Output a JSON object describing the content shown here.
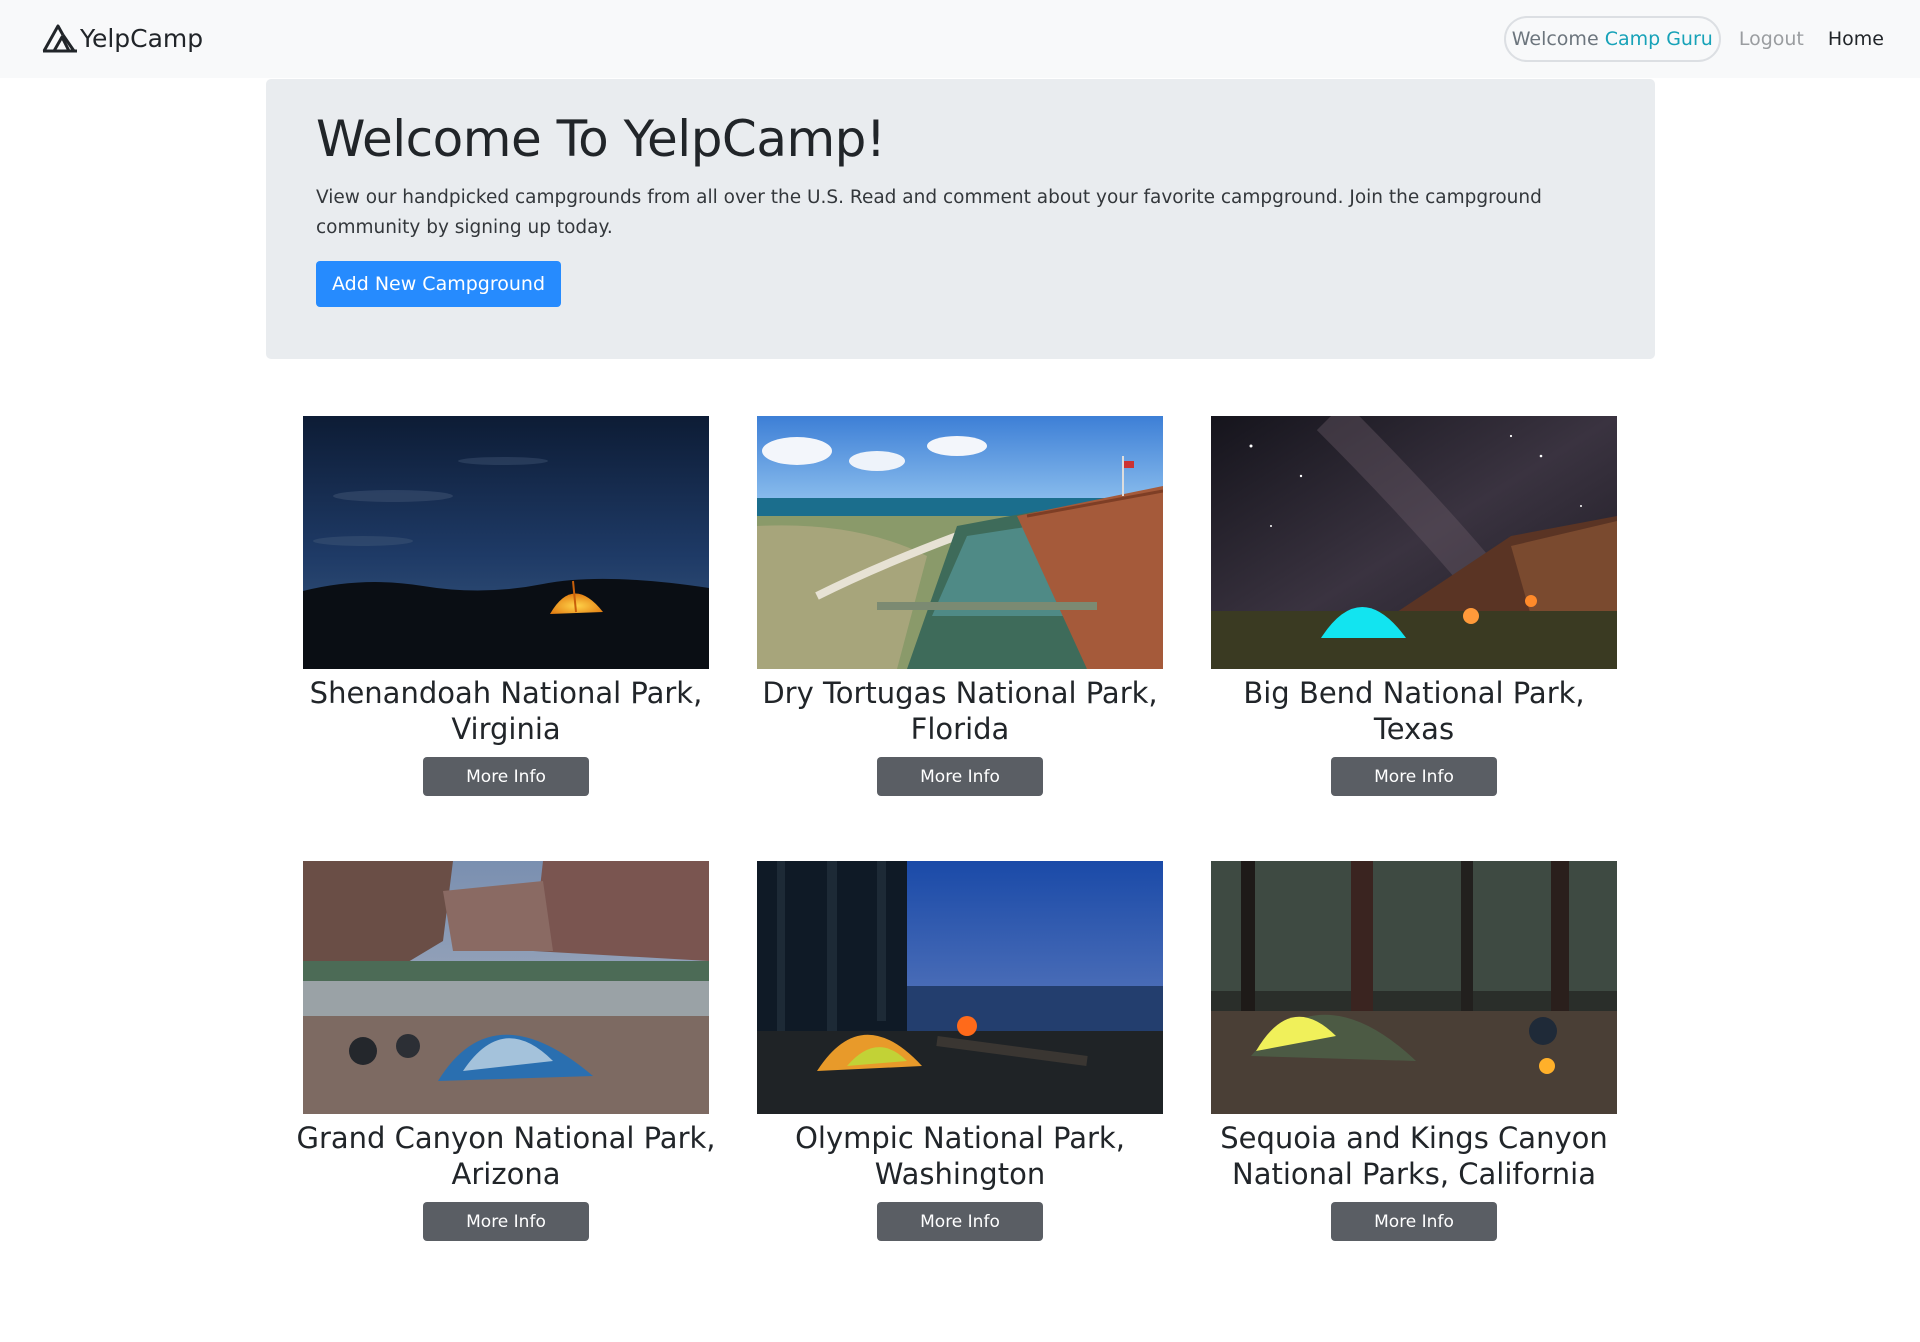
{
  "nav": {
    "brand": "YelpCamp",
    "welcome_prefix": "Welcome",
    "username": "Camp Guru",
    "logout": "Logout",
    "home": "Home"
  },
  "jumbotron": {
    "title": "Welcome To YelpCamp!",
    "lead": "View our handpicked campgrounds from all over the U.S. Read and comment about your favorite campground. Join the campground community by signing up today.",
    "add_button": "Add New Campground"
  },
  "campgrounds": [
    {
      "name": "Shenandoah National Park, Virginia",
      "button": "More Info"
    },
    {
      "name": "Dry Tortugas National Park, Florida",
      "button": "More Info"
    },
    {
      "name": "Big Bend National Park, Texas",
      "button": "More Info"
    },
    {
      "name": "Grand Canyon National Park, Arizona",
      "button": "More Info"
    },
    {
      "name": "Olympic National Park, Washington",
      "button": "More Info"
    },
    {
      "name": "Sequoia and Kings Canyon National Parks, California",
      "button": "More Info"
    }
  ],
  "colors": {
    "navbar_bg": "#f8f9fa",
    "jumbotron_bg": "#e9ecef",
    "primary": "#268bfe",
    "secondary": "#5a5e64",
    "accent_username": "#17a2b8"
  }
}
